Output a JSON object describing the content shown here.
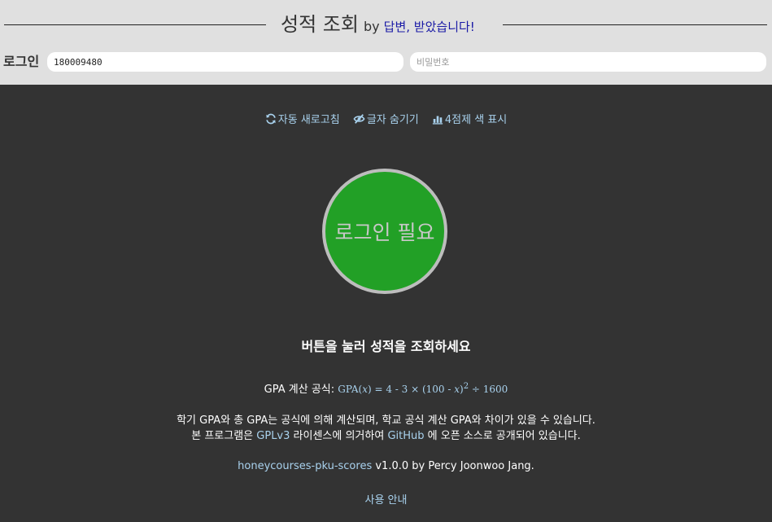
{
  "header": {
    "title": "성적 조회",
    "by": "by",
    "link_text": "답변, 받았습니다!"
  },
  "login": {
    "label": "로그인",
    "username_value": "180009480",
    "password_placeholder": "비밀번호"
  },
  "toolbar": {
    "auto_refresh": "자동 새로고침",
    "hide_text": "글자 숨기기",
    "four_point_color": "4점제 색 표시"
  },
  "status_circle": {
    "label": "로그인 필요",
    "color": "#22a026"
  },
  "prompt": "버튼을 눌러 성적을 조회하세요",
  "formula": {
    "label": "GPA 계산 공식:",
    "gpa": "GPA(",
    "x1": "x",
    "mid": ") = 4 - 3 × (100 - ",
    "x2": "x",
    "close": ")",
    "exp": "2",
    "tail": " ÷ 1600"
  },
  "notes": {
    "line1": "학기 GPA와 총 GPA는 공식에 의해 계산되며, 학교 공식 계산 GPA와 차이가 있을 수 있습니다.",
    "line2_prefix": "본 프로그램은 ",
    "gplv3": "GPLv3",
    "line2_mid": " 라이센스에 의거하여 ",
    "github": "GitHub",
    "line2_suffix": " 에 오픈 소스로 공개되어 있습니다."
  },
  "credit": {
    "project": "honeycourses-pku-scores",
    "rest": " v1.0.0 by Percy Joonwoo Jang."
  },
  "guide": "사용 안내",
  "colors": {
    "header_bg": "#e0e0e0",
    "main_bg": "#333333",
    "link": "#a9d2ee",
    "title_link": "#1a1aa6"
  },
  "icons": {
    "refresh": "refresh-icon",
    "hide": "eye-slash-icon",
    "chart": "chart-icon"
  }
}
